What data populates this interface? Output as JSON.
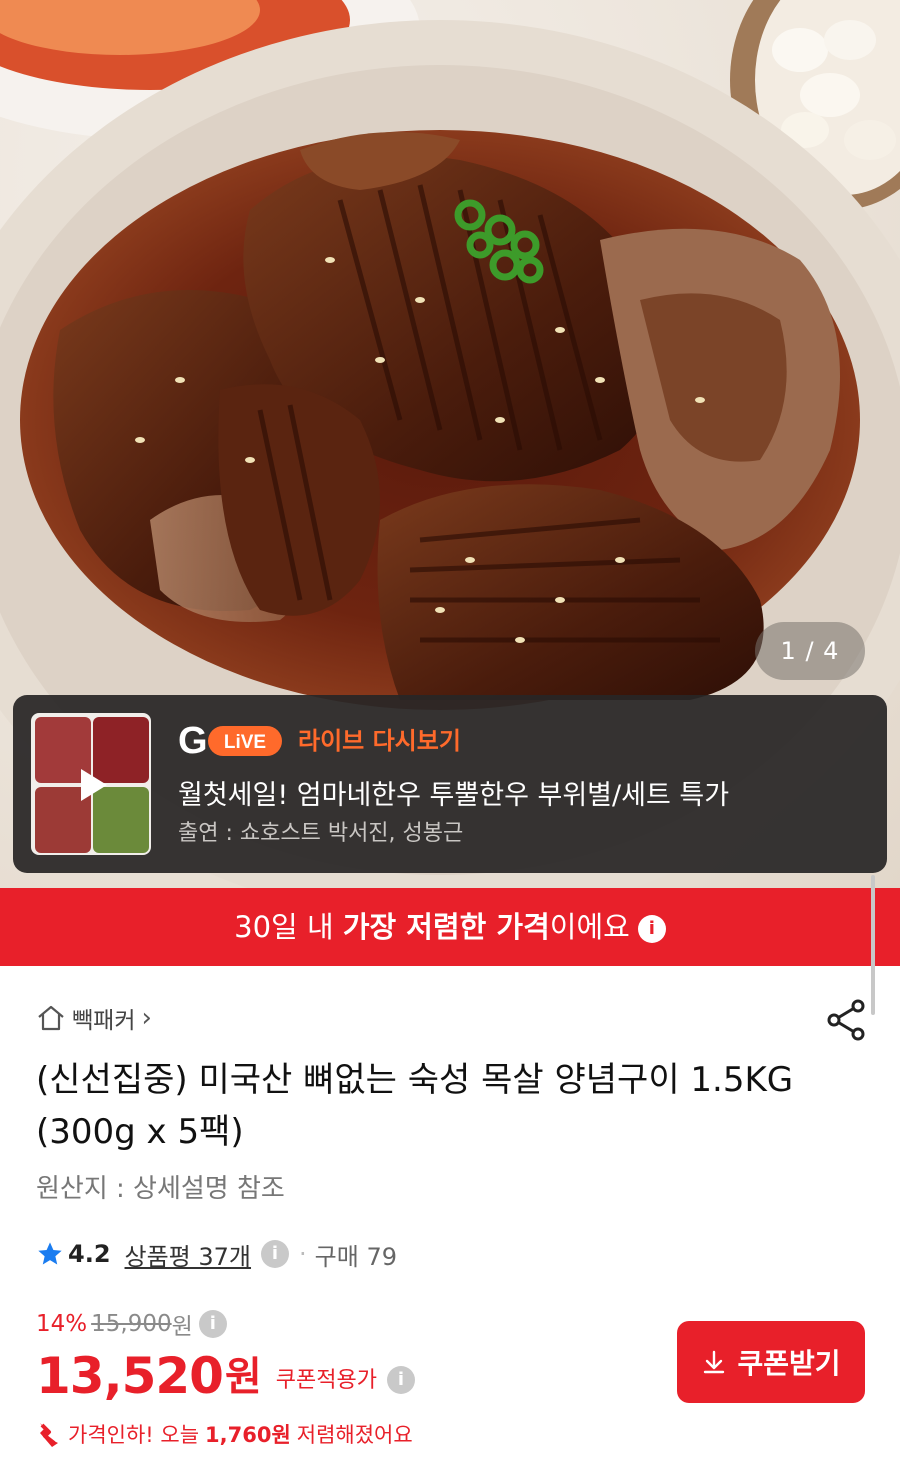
{
  "gallery": {
    "indicator": "1 / 4",
    "image_alt": "braised pork neck galbi in soy sauce glaze"
  },
  "live": {
    "logo_g": "G",
    "logo_live": "LiVE",
    "title": "라이브 다시보기",
    "headline": "월첫세일! 엄마네한우 투뿔한우 부위별/세트 특가",
    "cast": "출연 : 쇼호스트 박서진, 성봉근"
  },
  "price_banner": {
    "prefix": "30일 내 ",
    "bold": "가장 저렴한 가격",
    "suffix": "이에요",
    "info": "i"
  },
  "store": {
    "name": "빽패커",
    "chevron": "›"
  },
  "product": {
    "title": "(신선집중) 미국산 뼈없는 숙성 목살 양념구이 1.5KG (300g x 5팩)",
    "origin": "원산지 : 상세설명 참조"
  },
  "rating": {
    "score": "4.2",
    "reviews": "상품평 37개",
    "info": "i",
    "separator": "·",
    "purchases": "구매 79"
  },
  "pricing": {
    "discount": "14%",
    "original": "15,900",
    "original_unit": "원",
    "price": "13,520",
    "price_unit": "원",
    "coupon_applied": "쿠폰적용가",
    "info": "i",
    "drop_prefix": "가격인하! 오늘",
    "drop_amount": "1,760원",
    "drop_suffix": "저렴해졌어요"
  },
  "coupon_button": {
    "label": "쿠폰받기"
  },
  "colors": {
    "brand_red": "#e8202a",
    "live_orange": "#ff6a2b",
    "live_card_bg": "#282626"
  },
  "icons": [
    "home-icon",
    "share-icon",
    "play-icon",
    "star-icon",
    "info-icon",
    "download-icon",
    "price-drop-arrow-icon"
  ]
}
